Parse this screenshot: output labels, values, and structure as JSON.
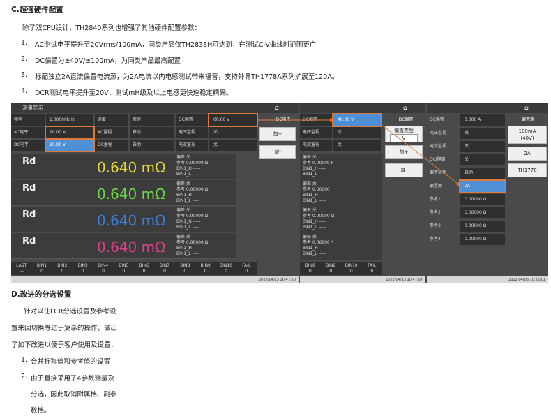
{
  "section_c": {
    "heading": "C.超强硬件配置",
    "intro": "除了双CPU设计，TH2840系列也增强了其他硬件配置参数：",
    "items": [
      {
        "num": "1.",
        "text": "AC测试电平提升至20Vrms/100mA，同类产品仅TH2838H可达到，在测试C-V曲线时范围更广"
      },
      {
        "num": "2.",
        "text": "DC偏置为±40V/±100mA，为同类产品最高配置"
      },
      {
        "num": "3.",
        "text": "标配独立2A直流偏置电流源，为2A电流以内电感测试带来福音，支持外界TH1778A系列扩展至120A。"
      },
      {
        "num": "4.",
        "text": "DCR测试电平提升至20V，测试mH级及以上电感更快速稳定精确。"
      }
    ]
  },
  "screen": {
    "panel1": {
      "title": "测量显示",
      "rows": [
        [
          "频率",
          "1.00000kHz",
          "速度",
          "慢速",
          "DC偏置",
          "00.00 V"
        ],
        [
          "AC电平",
          "20.00 V",
          "AC量程",
          "自动",
          "电压监视",
          "关"
        ],
        [
          "DC电平",
          "20.00 V",
          "DC量程",
          "自动",
          "电流监视",
          "关"
        ]
      ],
      "blocks": [
        {
          "label": "Rd",
          "value": "0.640 mΩ",
          "color": "#e8d640",
          "params": [
            "偏差  关",
            "参考  0.00000 Ω",
            "BIN1_H  -----",
            "BIN1_L  -----"
          ]
        },
        {
          "label": "Rd",
          "value": "0.640 mΩ",
          "color": "#6fd64a",
          "params": [
            "偏差  关",
            "参考  0.00000 Ω",
            "BIN1_H  -----",
            "BIN1_L  -----"
          ]
        },
        {
          "label": "Rd",
          "value": "0.640 mΩ",
          "color": "#3f7fd8",
          "params": [
            "偏差  关",
            "参考  0.00000 Ω",
            "BIN1_H  -----",
            "BIN1_L  -----"
          ]
        },
        {
          "label": "Rd",
          "value": "0.640 mΩ",
          "color": "#e2408f",
          "params": [
            "偏差  关",
            "参考  0.00000 Ω",
            "BIN1_H  -----",
            "BIN1_L  -----"
          ]
        }
      ],
      "bin_headers": [
        "LAST",
        "BIN1",
        "BIN2",
        "BIN3",
        "BIN4",
        "BIN5",
        "BIN6",
        "BIN7",
        "BIN8",
        "BIN9",
        "BIN10",
        "FAIL"
      ],
      "bin_values": [
        "---",
        "0",
        "0",
        "0",
        "0",
        "0",
        "0",
        "0",
        "0",
        "0",
        "0",
        "0"
      ],
      "side_title": "DC电平",
      "btn_plus": "加+",
      "btn_minus": "减-",
      "timestamp": "2022/04/13 10:47:50"
    },
    "panel2": {
      "rows": [
        [
          "DC偏置",
          "40.00 V"
        ],
        [
          "电压监视",
          "关"
        ],
        [
          "电流监视",
          "关"
        ]
      ],
      "blocks": [
        [
          "偏差  关",
          "参考  0.00000 F",
          "BIN1_H  -----",
          "BIN1_L  -----"
        ],
        [
          "偏差  关",
          "参考  0.00000",
          "BIN1_H  -----",
          "BIN1_L  -----"
        ],
        [
          "偏差  关",
          "参考  0.00000 Ω",
          "BIN1_H  -----",
          "BIN1_L  -----"
        ],
        [
          "偏差  关",
          "参考  0.00000 *",
          "BIN1_H  -----",
          "BIN1_L  -----"
        ]
      ],
      "bin_headers": [
        "BIN8",
        "BIN9",
        "BIN10",
        "FAIL"
      ],
      "bin_values": [
        "0",
        "0",
        "0",
        "0"
      ],
      "side_title": "DC偏置",
      "type_label": "偏置类型",
      "type_value": "V",
      "btn_plus": "加+",
      "btn_minus": "减-",
      "timestamp": "2022/04/13 10:47:07"
    },
    "panel3": {
      "rows": [
        [
          "DC偏置",
          "0.000 A"
        ],
        [
          "电压监视",
          "关"
        ],
        [
          "电流监视",
          "关"
        ],
        [
          "DCI隔离",
          "关"
        ],
        [
          "偏置极性",
          "自动"
        ],
        [
          "偏置源",
          "2A"
        ],
        [
          "参考1",
          "0.00000 Ω"
        ],
        [
          "参考2",
          "0.00000 Ω"
        ],
        [
          "参考3",
          "0.00000 Ω"
        ],
        [
          "参考4",
          "0.00000 Ω"
        ]
      ],
      "side_title": "偏置源",
      "btn_1": "100mA\n(40V)",
      "btn_2": "2A",
      "btn_3": "TH1778",
      "timestamp": "2022/04/06 10:25:01"
    }
  },
  "section_d": {
    "heading": "D.改进的分选设置",
    "para_lines": [
      "针对以往LCR分选设置及参考设",
      "置来回切换等过于复杂的操作，做出",
      "了如下改进以便于客户使用及设置："
    ],
    "items": [
      {
        "num": "1.",
        "lines": [
          "合并标称值和参考值的设置"
        ]
      },
      {
        "num": "2.",
        "lines": [
          "由于直接采用了4参数测量及",
          "分选，因此取消附属档、副参",
          "数档。"
        ]
      }
    ]
  },
  "colors": {
    "accent_orange": "#e07a3a",
    "highlight_blue": "#4f8fd6"
  }
}
